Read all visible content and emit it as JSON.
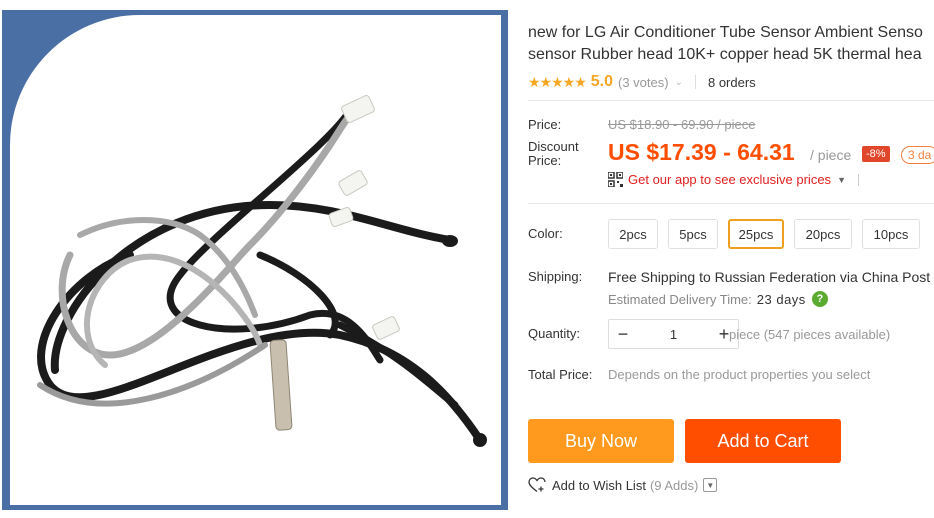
{
  "product": {
    "title_line1": "new for LG Air Conditioner Tube Sensor Ambient Senso",
    "title_line2": "sensor Rubber head 10K+ copper head 5K thermal hea"
  },
  "rating": {
    "stars": "★★★★★",
    "value": "5.0",
    "votes": "(3 votes)",
    "votes_chevron": "⌄",
    "orders": "8 orders"
  },
  "pricing": {
    "price_label": "Price:",
    "original_price": "US $18.90 - 69.90 / piece",
    "discount_label_1": "Discount",
    "discount_label_2": "Price:",
    "discount_price": "US $17.39 - 64.31",
    "per_piece": "/ piece",
    "discount_badge": "-8%",
    "days_badge": "3 da",
    "app_promo": "Get our app to see exclusive prices",
    "app_caret": "▼"
  },
  "options": {
    "color_label": "Color:",
    "items": [
      "2pcs",
      "5pcs",
      "25pcs",
      "20pcs",
      "10pcs"
    ],
    "selected": "25pcs"
  },
  "shipping": {
    "label": "Shipping:",
    "free": "Free Shipping",
    "to": "to Russian Federation via China Post",
    "estimated_label": "Estimated Delivery Time:",
    "estimated_days": "23 days",
    "help": "?"
  },
  "quantity": {
    "label": "Quantity:",
    "minus": "−",
    "value": "1",
    "plus": "+",
    "available": "piece (547 pieces available)"
  },
  "total": {
    "label": "Total Price:",
    "text": "Depends on the product properties you select"
  },
  "actions": {
    "buy_now": "Buy Now",
    "add_to_cart": "Add to Cart",
    "wish_list": "Add to Wish List",
    "wish_count": "(9 Adds)",
    "wish_dropdown": "▼"
  },
  "colors": {
    "accent_orange": "#ff4e00",
    "buy_now_orange": "#ff9a1f",
    "star_color": "#f5a623",
    "image_frame_blue": "#4a6fa5"
  }
}
